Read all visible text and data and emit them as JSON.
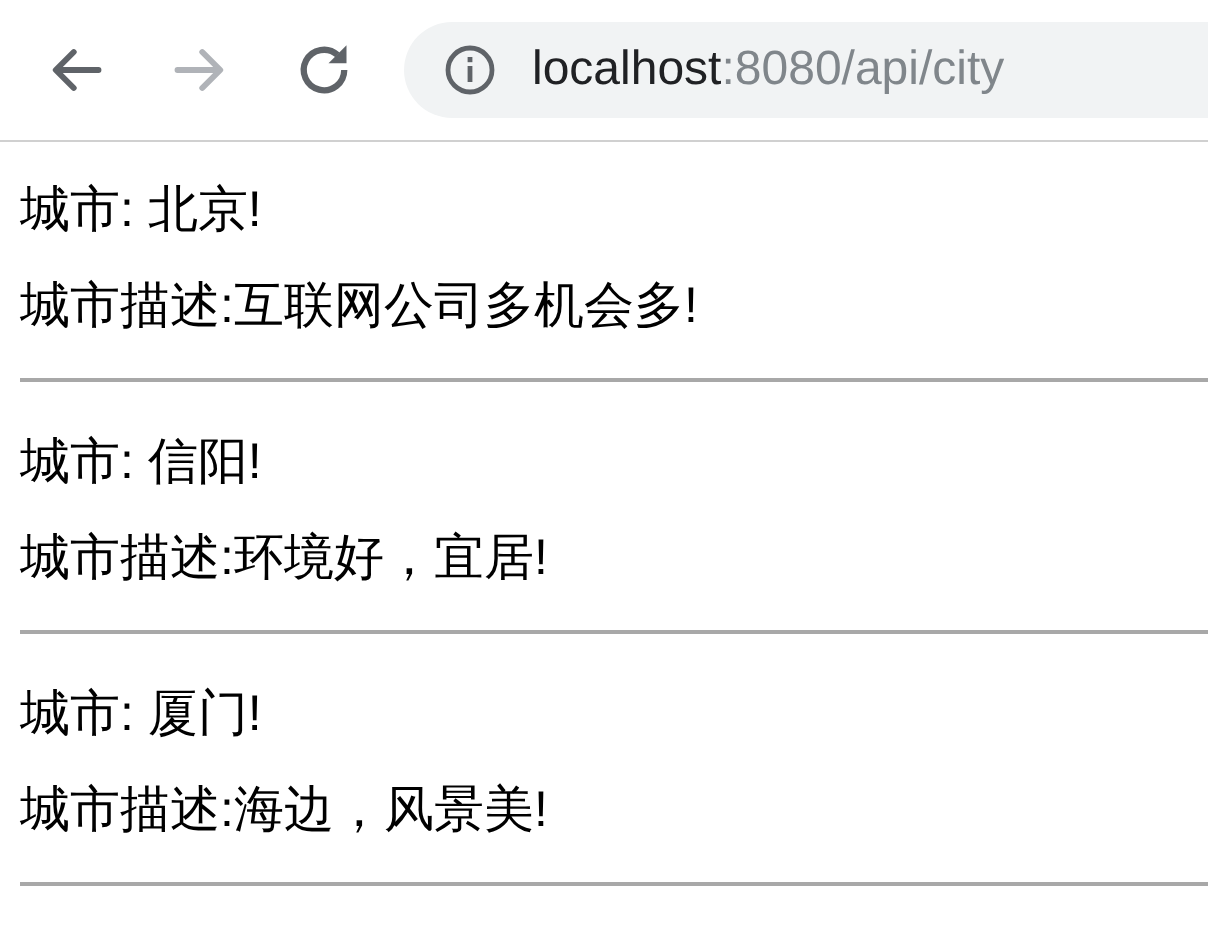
{
  "toolbar": {
    "nav_buttons": [
      {
        "kind": "back",
        "disabled": false
      },
      {
        "kind": "forward",
        "disabled": true
      },
      {
        "kind": "reload",
        "disabled": false
      }
    ],
    "address": {
      "host": "localhost",
      "path": ":8080/api/city"
    }
  },
  "cities": [
    {
      "city": "城市: 北京!",
      "description": "城市描述:互联网公司多机会多!"
    },
    {
      "city": "城市: 信阳!",
      "description": "城市描述:环境好，宜居!"
    },
    {
      "city": "城市: 厦门!",
      "description": "城市描述:海边，风景美!"
    }
  ]
}
